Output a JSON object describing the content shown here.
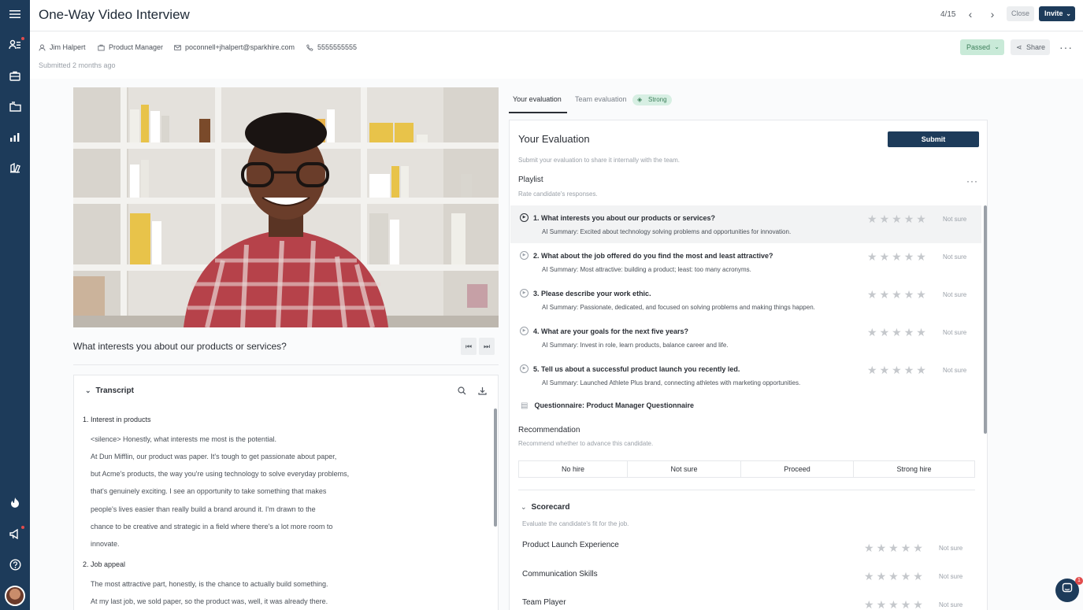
{
  "header": {
    "title": "One-Way Video Interview",
    "pager": "4/15",
    "close_label": "Close",
    "invite_label": "Invite"
  },
  "candidate": {
    "name": "Jim Halpert",
    "role": "Product Manager",
    "email": "poconnell+jhalpert@sparkhire.com",
    "phone": "5555555555",
    "submitted": "Submitted 2 months ago",
    "status_label": "Passed",
    "share_label": "Share"
  },
  "video": {
    "question": "What interests you about our products or services?"
  },
  "transcript": {
    "title": "Transcript",
    "sections": [
      {
        "heading": "1. Interest in products",
        "lines": [
          "<silence> Honestly, what interests me most is the potential.",
          "At Dun Mifflin, our product was paper. It's tough to get passionate about paper,",
          "but Acme's products, the way you're using technology to solve everyday problems,",
          "that's genuinely exciting. I see an opportunity to take something that makes",
          "people's lives easier than really build a brand around it. I'm drawn to the",
          "chance to be creative and strategic in a field where there's a lot more room to",
          "innovate."
        ]
      },
      {
        "heading": "2. Job appeal",
        "lines": [
          "The most attractive part, honestly, is the chance to actually build something.",
          "At my last job, we sold paper, so the product was, well, it was already there."
        ]
      }
    ]
  },
  "tabs": {
    "your_eval": "Your evaluation",
    "team_eval": "Team evaluation",
    "team_badge": "Strong"
  },
  "evaluation": {
    "title": "Your Evaluation",
    "submit_label": "Submit",
    "subtitle": "Submit your evaluation to share it internally with the team.",
    "playlist_title": "Playlist",
    "playlist_sub": "Rate candidate's responses.",
    "not_sure": "Not sure",
    "questions": [
      {
        "text": "1. What interests you about our products or services?",
        "summary": "AI Summary: Excited about technology solving problems and opportunities for innovation."
      },
      {
        "text": "2. What about the job offered do you find the most and least attractive?",
        "summary": "AI Summary: Most attractive: building a product; least: too many acronyms."
      },
      {
        "text": "3. Please describe your work ethic.",
        "summary": "AI Summary: Passionate, dedicated, and focused on solving problems and making things happen."
      },
      {
        "text": "4. What are your goals for the next five years?",
        "summary": "AI Summary: Invest in role, learn products, balance career and life."
      },
      {
        "text": "5. Tell us about a successful product launch you recently led.",
        "summary": "AI Summary: Launched Athlete Plus brand, connecting athletes with marketing opportunities."
      }
    ],
    "questionnaire": "Questionnaire: Product Manager Questionnaire",
    "recommendation_title": "Recommendation",
    "recommendation_sub": "Recommend whether to advance this candidate.",
    "recommendation_options": [
      "No hire",
      "Not sure",
      "Proceed",
      "Strong hire"
    ],
    "scorecard_title": "Scorecard",
    "scorecard_sub": "Evaluate the candidate's fit for the job.",
    "scorecard_items": [
      "Product Launch Experience",
      "Communication Skills",
      "Team Player"
    ]
  },
  "chat": {
    "badge": "1"
  }
}
